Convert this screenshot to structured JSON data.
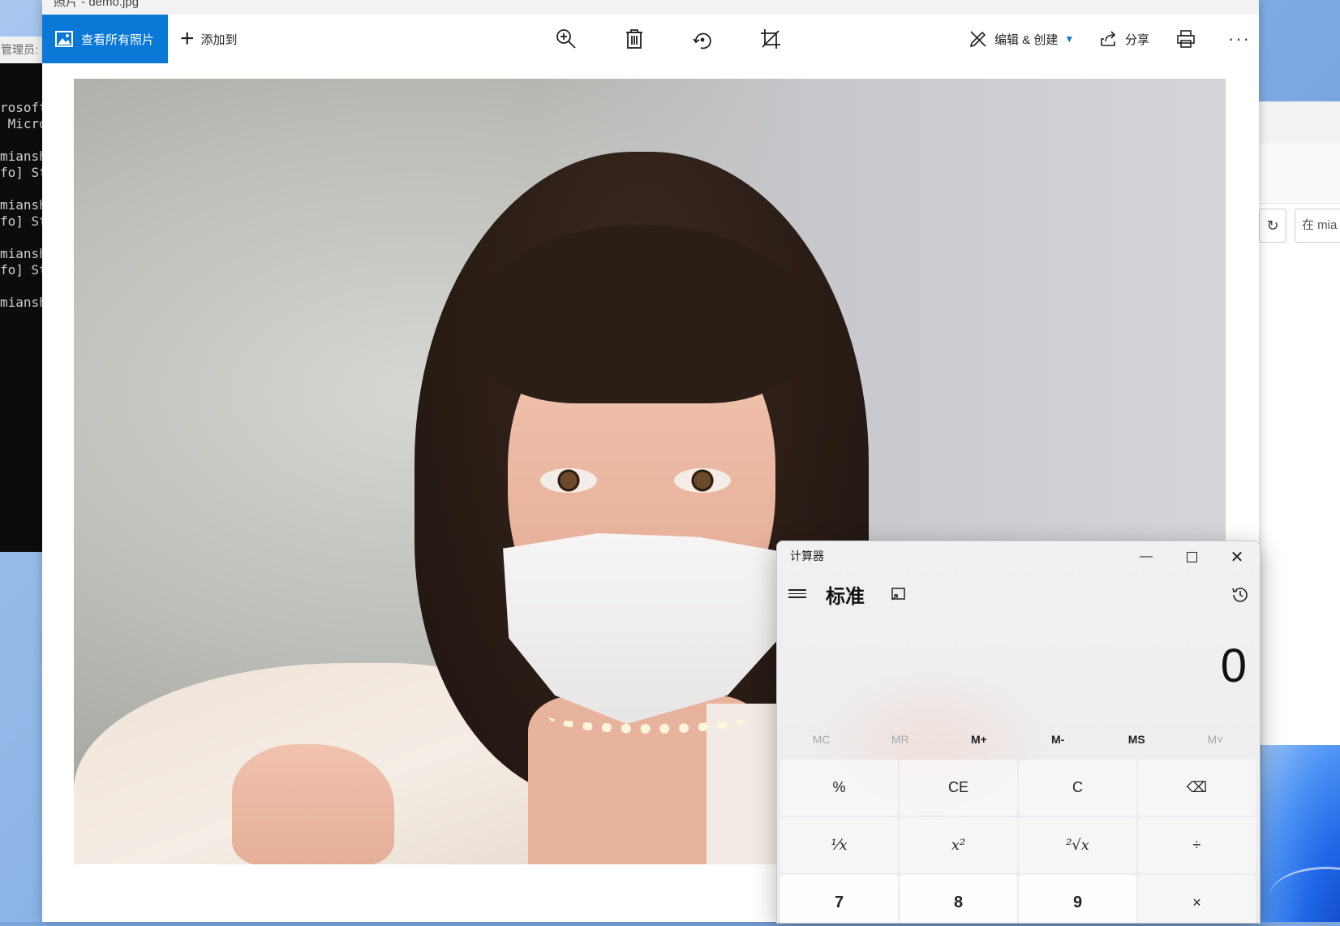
{
  "photos": {
    "window_title": "照片 - demo.jpg",
    "all_photos_label": "查看所有照片",
    "add_to_label": "添加到",
    "edit_create_label": "编辑 & 创建",
    "share_label": "分享",
    "more_label": "···"
  },
  "console": {
    "title": "管理员:",
    "lines": [
      "rosoft",
      " Micro",
      "",
      "miansh",
      "fo] St",
      "",
      "miansh",
      "fo] St",
      "",
      "miansh",
      "fo] St",
      "",
      "miansh"
    ]
  },
  "explorer": {
    "search_placeholder": "在 mia"
  },
  "calculator": {
    "title": "计算器",
    "mode": "标准",
    "display_value": "0",
    "memory_buttons": [
      {
        "label": "MC",
        "enabled": false
      },
      {
        "label": "MR",
        "enabled": false
      },
      {
        "label": "M+",
        "enabled": true
      },
      {
        "label": "M-",
        "enabled": true
      },
      {
        "label": "MS",
        "enabled": true
      },
      {
        "label": "M˅",
        "enabled": false
      }
    ],
    "keys": [
      "%",
      "CE",
      "C",
      "⌫",
      "¹⁄x",
      "x²",
      "²√x",
      "÷",
      "7",
      "8",
      "9",
      "×"
    ]
  }
}
